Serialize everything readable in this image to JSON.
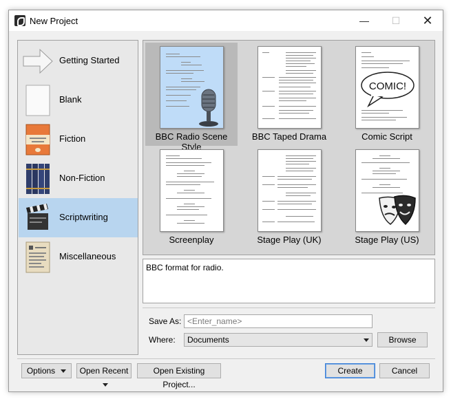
{
  "window": {
    "title": "New Project",
    "minimize_icon": "minimize-icon",
    "maximize_icon": "maximize-icon",
    "close_icon": "close-icon"
  },
  "categories": [
    {
      "label": "Getting Started",
      "icon": "arrow-icon",
      "selected": false
    },
    {
      "label": "Blank",
      "icon": "blank-page-icon",
      "selected": false
    },
    {
      "label": "Fiction",
      "icon": "book-icon",
      "selected": false
    },
    {
      "label": "Non-Fiction",
      "icon": "books-icon",
      "selected": false
    },
    {
      "label": "Scriptwriting",
      "icon": "clapperboard-icon",
      "selected": true
    },
    {
      "label": "Miscellaneous",
      "icon": "notes-icon",
      "selected": false
    }
  ],
  "templates": [
    {
      "label": "BBC Radio Scene Style",
      "icon": "microphone-icon",
      "selected": true
    },
    {
      "label": "BBC Taped Drama",
      "icon": "script-page-icon",
      "selected": false
    },
    {
      "label": "Comic Script",
      "icon": "speech-bubble-icon",
      "selected": false,
      "bubble_text": "COMIC!"
    },
    {
      "label": "Screenplay",
      "icon": "script-page-icon",
      "selected": false
    },
    {
      "label": "Stage Play (UK)",
      "icon": "script-page-icon",
      "selected": false
    },
    {
      "label": "Stage Play (US)",
      "icon": "theatre-masks-icon",
      "selected": false
    }
  ],
  "description": "BBC format for radio.",
  "form": {
    "save_as_label": "Save As:",
    "save_as_placeholder": "<Enter_name>",
    "save_as_value": "",
    "where_label": "Where:",
    "where_value": "Documents",
    "browse_label": "Browse"
  },
  "footer": {
    "options_label": "Options",
    "open_recent_label": "Open Recent",
    "open_existing_label": "Open Existing Project...",
    "create_label": "Create",
    "cancel_label": "Cancel"
  },
  "colors": {
    "selected_category": "#b8d5ef",
    "selected_template": "#b9b9b9",
    "default_button_border": "#3c7fd6"
  }
}
